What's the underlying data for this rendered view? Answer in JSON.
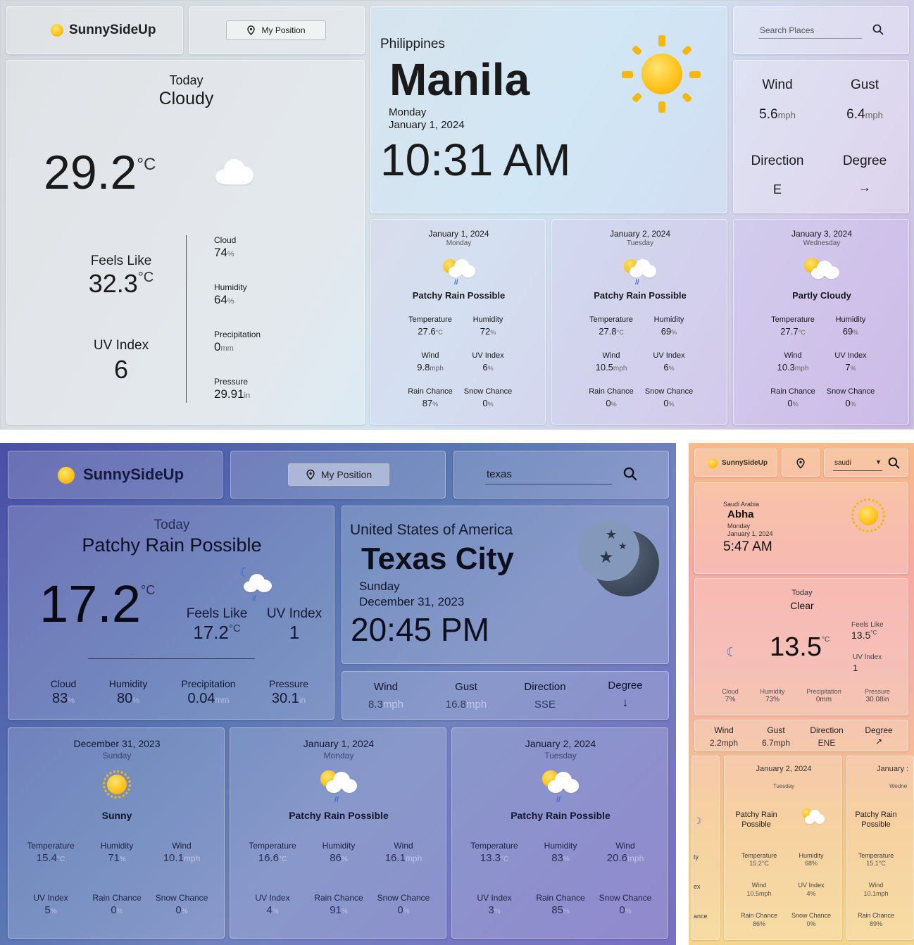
{
  "s1": {
    "brand": "SunnySideUp",
    "position_label": "My Position",
    "search_placeholder": "Search Places",
    "today": {
      "label": "Today",
      "condition": "Cloudy",
      "temp": "29.2",
      "temp_unit": "°C",
      "feels_label": "Feels Like",
      "feels": "32.3",
      "feels_unit": "°C",
      "uv_label": "UV Index",
      "uv": "6",
      "cloud_label": "Cloud",
      "cloud": "74",
      "cloud_unit": "%",
      "humidity_label": "Humidity",
      "humidity": "64",
      "humidity_unit": "%",
      "precip_label": "Precipitation",
      "precip": "0",
      "precip_unit": "mm",
      "pressure_label": "Pressure",
      "pressure": "29.91",
      "pressure_unit": "in"
    },
    "location": {
      "country": "Philippines",
      "city": "Manila",
      "day": "Monday",
      "date": "January 1, 2024",
      "time": "10:31 AM"
    },
    "wind": {
      "wind_label": "Wind",
      "wind": "5.6",
      "wind_unit": "mph",
      "gust_label": "Gust",
      "gust": "6.4",
      "gust_unit": "mph",
      "dir_label": "Direction",
      "dir": "E",
      "deg_label": "Degree",
      "deg_arrow": "→"
    },
    "forecast": [
      {
        "date": "January 1, 2024",
        "day": "Monday",
        "condition": "Patchy Rain Possible",
        "icon": "sun-cloud-rain-icon",
        "temp": "27.6",
        "humidity": "72",
        "wind": "9.8",
        "uv": "6",
        "rain": "87",
        "snow": "0"
      },
      {
        "date": "January 2, 2024",
        "day": "Tuesday",
        "condition": "Patchy Rain Possible",
        "icon": "sun-cloud-rain-icon",
        "temp": "27.8",
        "humidity": "69",
        "wind": "10.5",
        "uv": "6",
        "rain": "0",
        "snow": "0"
      },
      {
        "date": "January 3, 2024",
        "day": "Wednesday",
        "condition": "Partly Cloudy",
        "icon": "sun-cloud-icon",
        "temp": "27.7",
        "humidity": "69",
        "wind": "10.3",
        "uv": "7",
        "rain": "0",
        "snow": "0"
      }
    ],
    "labels": {
      "temperature": "Temperature",
      "humidity": "Humidity",
      "wind": "Wind",
      "uv": "UV Index",
      "rain": "Rain Chance",
      "snow": "Snow Chance",
      "c": "°C",
      "pct": "%",
      "mph": "mph"
    }
  },
  "s2": {
    "brand": "SunnySideUp",
    "position_label": "My Position",
    "search_value": "texas",
    "today": {
      "label": "Today",
      "condition": "Patchy Rain Possible",
      "temp": "17.2",
      "temp_unit": "°C",
      "feels_label": "Feels Like",
      "feels": "17.2",
      "feels_unit": "°C",
      "uv_label": "UV Index",
      "uv": "1",
      "cloud_label": "Cloud",
      "cloud": "83",
      "humidity_label": "Humidity",
      "humidity": "80",
      "precip_label": "Precipitation",
      "precip": "0.04",
      "precip_unit": "mm",
      "pressure_label": "Pressure",
      "pressure": "30.1",
      "pressure_unit": "in"
    },
    "location": {
      "country": "United States of America",
      "city": "Texas City",
      "day": "Sunday",
      "date": "December 31, 2023",
      "time": "20:45 PM"
    },
    "wind": {
      "wind_label": "Wind",
      "wind": "8.3",
      "gust_label": "Gust",
      "gust": "16.8",
      "dir_label": "Direction",
      "dir": "SSE",
      "deg_label": "Degree",
      "deg_arrow": "↓"
    },
    "forecast": [
      {
        "date": "December 31, 2023",
        "day": "Sunday",
        "condition": "Sunny",
        "temp": "15.4",
        "humidity": "71",
        "wind": "10.1",
        "uv": "5",
        "rain": "0",
        "snow": "0"
      },
      {
        "date": "January 1, 2024",
        "day": "Monday",
        "condition": "Patchy Rain Possible",
        "temp": "16.6",
        "humidity": "86",
        "wind": "16.1",
        "uv": "4",
        "rain": "91",
        "snow": "0"
      },
      {
        "date": "January 2, 2024",
        "day": "Tuesday",
        "condition": "Patchy Rain Possible",
        "temp": "13.3",
        "humidity": "83",
        "wind": "20.6",
        "uv": "3",
        "rain": "85",
        "snow": "0"
      }
    ]
  },
  "s3": {
    "brand": "SunnySideUp",
    "search_value": "saudi",
    "location": {
      "country": "Saudi Arabia",
      "city": "Abha",
      "day": "Monday",
      "date": "January 1, 2024",
      "time": "5:47 AM"
    },
    "today": {
      "label": "Today",
      "condition": "Clear",
      "temp": "13.5",
      "temp_unit": "°C",
      "feels_label": "Feels Like",
      "feels": "13.5",
      "feels_unit": "°C",
      "uv_label": "UV Index",
      "uv": "1",
      "cloud_label": "Cloud",
      "cloud": "7%",
      "humidity_label": "Humidity",
      "humidity": "73%",
      "precip_label": "Precipitation",
      "precip": "0mm",
      "pressure_label": "Pressure",
      "pressure": "30.08in"
    },
    "wind": {
      "wind_label": "Wind",
      "wind": "2.2mph",
      "gust_label": "Gust",
      "gust": "6.7mph",
      "dir_label": "Direction",
      "dir": "ENE",
      "deg_label": "Degree",
      "deg_arrow": "↗"
    },
    "forecast_left": {
      "l1": "ty",
      "l2": "ex",
      "l3": "ance"
    },
    "forecast_mid": {
      "date": "January 2, 2024",
      "day": "Tuesday",
      "condition": "Patchy Rain Possible",
      "temp": "15.2°C",
      "humidity": "68%",
      "wind": "10.5mph",
      "uv": "4%",
      "rain": "86%",
      "snow": "0%"
    },
    "forecast_right": {
      "date": "January :",
      "day": "Wedne",
      "condition": "Patchy Rain Possible",
      "temp": "15.1°C",
      "wind": "10.1mph",
      "rain": "89%"
    }
  }
}
